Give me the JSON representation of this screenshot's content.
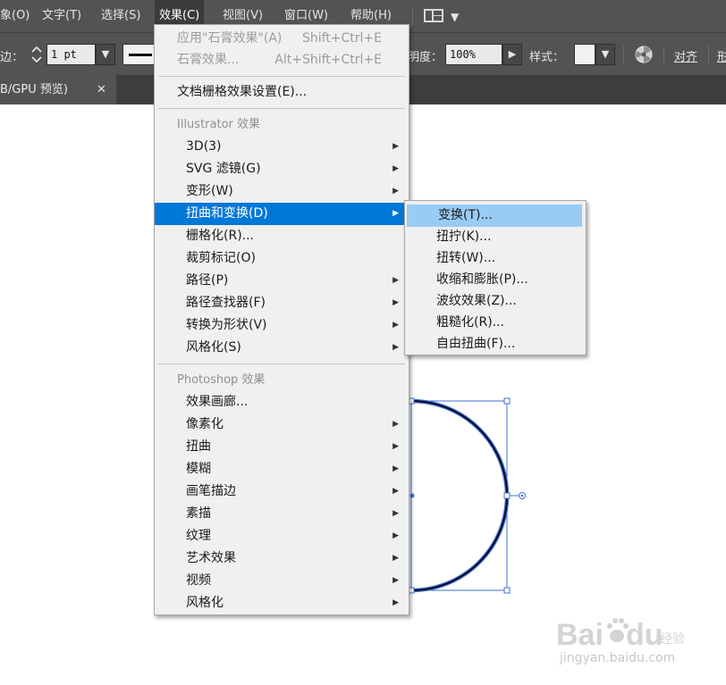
{
  "menubar": {
    "items": [
      {
        "label": "象(O)"
      },
      {
        "label": "文字(T)"
      },
      {
        "label": "选择(S)"
      },
      {
        "label": "效果(C)"
      },
      {
        "label": "视图(V)"
      },
      {
        "label": "窗口(W)"
      },
      {
        "label": "帮助(H)"
      }
    ],
    "active_item": "效果(C)"
  },
  "controlbar": {
    "stroke_label": "边：",
    "stroke_weight": "1 pt",
    "opacity_label": "明度：",
    "opacity_value": "100%",
    "style_label": "样式：",
    "align_label": "对齐",
    "transform_label_partial": "形"
  },
  "document_tab": {
    "label": "B/GPU 预览)",
    "close_glyph": "✕"
  },
  "effect_menu": {
    "items": [
      {
        "label": "应用\"石膏效果\"(A)",
        "shortcut": "Shift+Ctrl+E",
        "disabled": true
      },
      {
        "label": "石膏效果...",
        "shortcut": "Alt+Shift+Ctrl+E",
        "disabled": true
      },
      {
        "label": "文档栅格效果设置(E)..."
      },
      {
        "section": "Illustrator 效果"
      },
      {
        "label": "3D(3)",
        "submenu": true
      },
      {
        "label": "SVG 滤镜(G)",
        "submenu": true
      },
      {
        "label": "变形(W)",
        "submenu": true
      },
      {
        "label": "扭曲和变换(D)",
        "submenu": true,
        "highlighted": true
      },
      {
        "label": "栅格化(R)..."
      },
      {
        "label": "裁剪标记(O)"
      },
      {
        "label": "路径(P)",
        "submenu": true
      },
      {
        "label": "路径查找器(F)",
        "submenu": true
      },
      {
        "label": "转换为形状(V)",
        "submenu": true
      },
      {
        "label": "风格化(S)",
        "submenu": true
      },
      {
        "section": "Photoshop 效果"
      },
      {
        "label": "效果画廊..."
      },
      {
        "label": "像素化",
        "submenu": true
      },
      {
        "label": "扭曲",
        "submenu": true
      },
      {
        "label": "模糊",
        "submenu": true
      },
      {
        "label": "画笔描边",
        "submenu": true
      },
      {
        "label": "素描",
        "submenu": true
      },
      {
        "label": "纹理",
        "submenu": true
      },
      {
        "label": "艺术效果",
        "submenu": true
      },
      {
        "label": "视频",
        "submenu": true
      },
      {
        "label": "风格化",
        "submenu": true
      }
    ],
    "submenu_arrow": "▶"
  },
  "distort_submenu": {
    "items": [
      {
        "label": "变换(T)...",
        "hovered": true
      },
      {
        "label": "扭拧(K)..."
      },
      {
        "label": "扭转(W)..."
      },
      {
        "label": "收缩和膨胀(P)..."
      },
      {
        "label": "波纹效果(Z)..."
      },
      {
        "label": "粗糙化(R)..."
      },
      {
        "label": "自由扭曲(F)..."
      }
    ]
  },
  "artwork": {
    "stroke_color": "#0a0a1e",
    "selection_color": "#3d6fd6"
  },
  "watermark": {
    "url": "jingyan.baidu.com"
  },
  "colors": {
    "panel_bg": "#535353",
    "menu_bg": "#f0f0f0",
    "highlight": "#0078d7",
    "hover": "#99ccf5"
  }
}
